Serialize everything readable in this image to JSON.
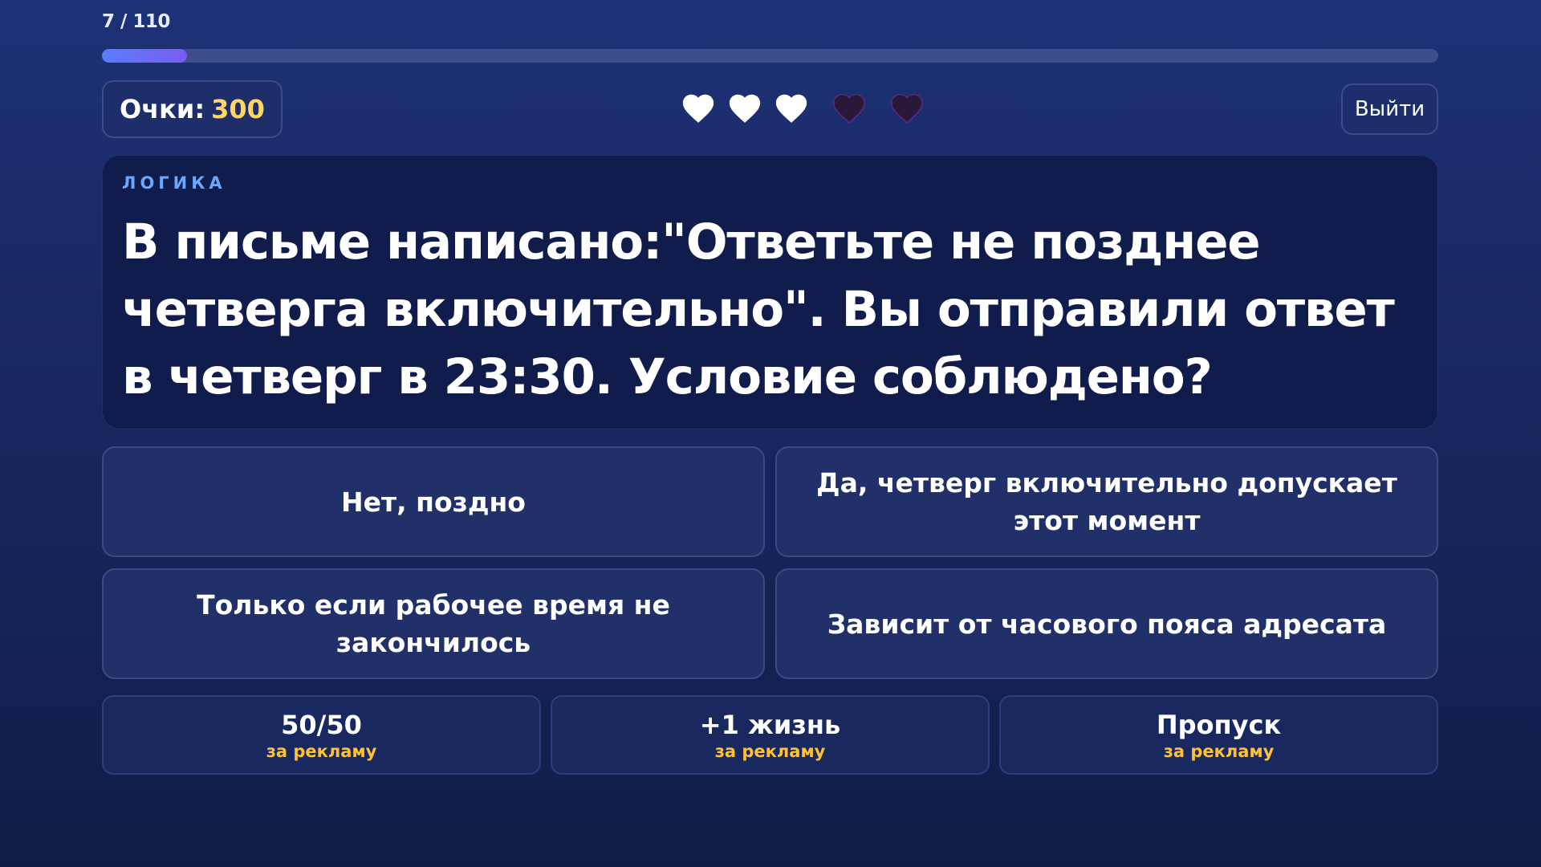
{
  "progress": {
    "label": "7 / 110",
    "current": 7,
    "total": 110
  },
  "score": {
    "label": "Очки:",
    "value": "300"
  },
  "lives": {
    "total": 5,
    "remaining": 3
  },
  "exit_label": "Выйти",
  "question": {
    "category": "ЛОГИКА",
    "text": "В письме написано:\"Ответьте не позднее четверга включительно\". Вы отправили ответ в четверг в 23:30. Условие соблюдено?"
  },
  "answers": [
    {
      "label": "Нет, поздно"
    },
    {
      "label": "Да, четверг включительно допускает этот момент"
    },
    {
      "label": "Только если рабочее время не закончилось"
    },
    {
      "label": "Зависит от часового пояса адресата"
    }
  ],
  "powerups": [
    {
      "title": "50/50",
      "subtitle": "за рекламу"
    },
    {
      "title": "+1 жизнь",
      "subtitle": "за рекламу"
    },
    {
      "title": "Пропуск",
      "subtitle": "за рекламу"
    }
  ],
  "colors": {
    "accent_score": "#ffd666",
    "category": "#6aa8ff",
    "ad_label": "#ffc233",
    "heart_full": "#ffffff",
    "heart_empty": "#2a1838"
  },
  "icons": {
    "heart_full": "heart-full-icon",
    "heart_empty": "heart-empty-icon"
  }
}
